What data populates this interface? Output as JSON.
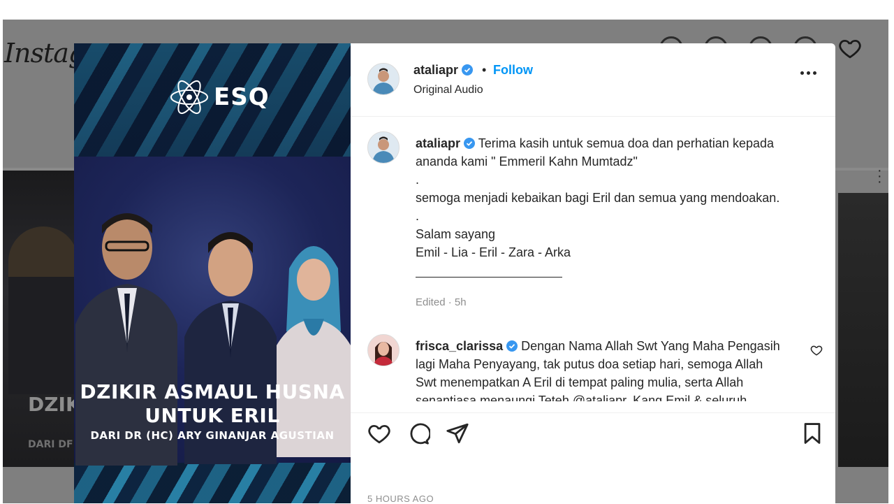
{
  "background": {
    "logo_text": "Instagr",
    "left_post_text1": "DZIK",
    "left_post_text2": "DARI DF"
  },
  "media": {
    "logo_text": "ESQ",
    "headline_line1": "DZIKIR ASMAUL HUSNA",
    "headline_line2": "UNTUK ERIL",
    "headline_line3": "DARI DR (HC) ARY GINANJAR AGUSTIAN"
  },
  "header": {
    "username": "ataliapr",
    "dot": "•",
    "follow_label": "Follow",
    "audio_label": "Original Audio"
  },
  "caption": {
    "username": "ataliapr",
    "lines": [
      "Terima kasih untuk semua doa dan perhatian kepada",
      "ananda kami \" Emmeril Kahn Mumtadz\"",
      ".",
      "semoga menjadi kebaikan bagi Eril dan semua yang mendoakan.",
      ".",
      "Salam sayang",
      "Emil - Lia - Eril - Zara - Arka"
    ],
    "edited_label": "Edited · 5h"
  },
  "comment": {
    "username": "frisca_clarissa",
    "lines": [
      "Dengan Nama Allah Swt Yang Maha Pengasih",
      "lagi Maha Penyayang, tak putus doa setiap hari, semoga Allah",
      "Swt menempatkan A Eril di tempat paling mulia, serta Allah",
      "senantiasa menaungi Teteh @ataliapr, Kang Emil & seluruh"
    ]
  },
  "footer": {
    "timestamp": "5 HOURS AGO"
  },
  "colors": {
    "accent_blue": "#0095f6",
    "verified_blue": "#3897f0",
    "muted_text": "#8e8e8e"
  },
  "icons": [
    "heart-icon",
    "comment-icon",
    "share-icon",
    "bookmark-icon",
    "more-icon",
    "verified-badge-icon"
  ]
}
